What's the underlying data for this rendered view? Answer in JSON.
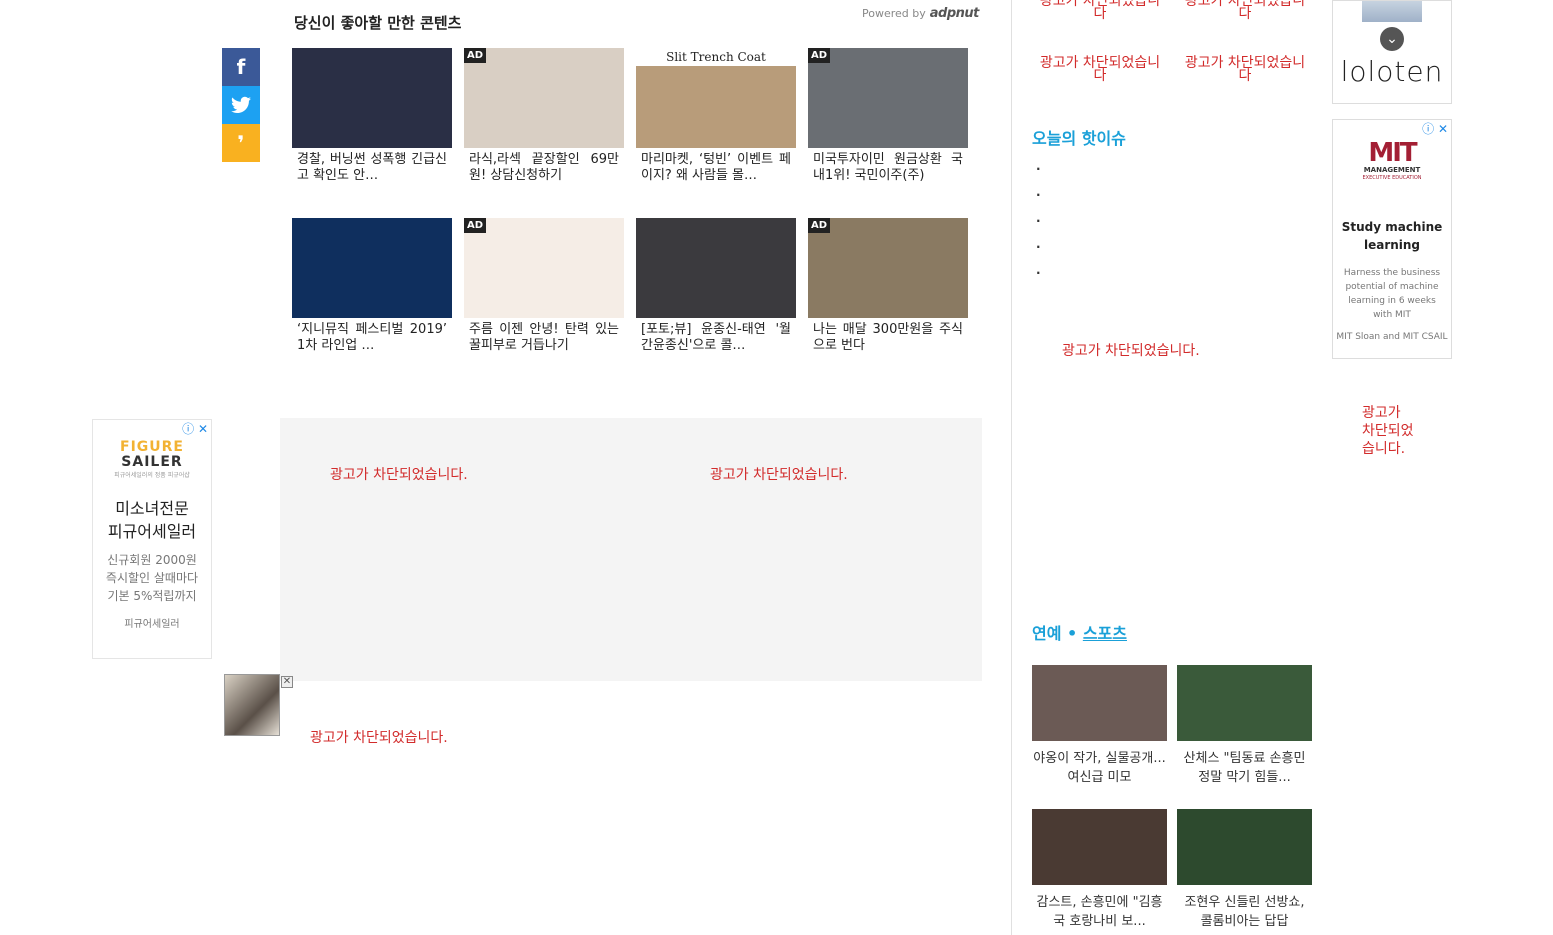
{
  "recommend": {
    "title": "당신이 좋아할 만한 콘텐츠",
    "powered_by": "Powered by",
    "powered_brand": "adpnut",
    "ad_tag": "AD",
    "cards": [
      {
        "caption": "경찰, 버닝썬 성폭행 긴급신고 확인도 안…",
        "ad": false,
        "thumb_color": "#2a2f45"
      },
      {
        "caption": "라식,라섹 끝장할인 69만원! 상담신청하기",
        "ad": true,
        "thumb_color": "#d9cfc4"
      },
      {
        "caption": "마리마켓, ‘텅빈’ 이벤트 페이지? 왜 사람들 몰…",
        "ad": false,
        "thumb_color": "#b89c7a",
        "thumb_text": "Slit Trench Coat"
      },
      {
        "caption": "미국투자이민 원금상환 국내1위! 국민이주(주)",
        "ad": true,
        "thumb_color": "#6a6e73"
      },
      {
        "caption": "‘지니뮤직 페스티벌 2019’ 1차 라인업 …",
        "ad": false,
        "thumb_color": "#0f2f5e"
      },
      {
        "caption": "주름 이젠 안녕! 탄력 있는 꿀피부로 거듭나기",
        "ad": true,
        "thumb_color": "#f5ede6"
      },
      {
        "caption": "[포토;뷰] 윤종신-태연 '월간윤종신'으로 콜…",
        "ad": false,
        "thumb_color": "#3b3a3e"
      },
      {
        "caption": "나는 매달 300만원을 주식으로 번다",
        "ad": true,
        "thumb_color": "#8a7a62"
      }
    ]
  },
  "social": {
    "facebook": "f",
    "twitter": "t",
    "kakaostory": "❜"
  },
  "blocked_text": "광고가 차단되었습니다.",
  "blocked_text_pieces": {
    "line1": "광고가 차단되었습니",
    "line2": "다"
  },
  "left_ad": {
    "logo_top": "FIGURE",
    "logo_bottom": "SAILER",
    "logo_sub": "피규어세일러의 정품 피규어샵",
    "title1": "미소녀전문",
    "title2": "피규어세일러",
    "desc1": "신규회원 2000원",
    "desc2": "즉시할인 살때마다",
    "desc3": "기본 5%적립까지",
    "brand": "피규어세일러",
    "close": "ⓘ ✕"
  },
  "hot_issue": {
    "title": "오늘의 핫이슈",
    "items": [
      "",
      "",
      "",
      "",
      ""
    ]
  },
  "sports": {
    "title_part1": "연예",
    "title_sep": " • ",
    "title_part2": "스포츠",
    "cards": [
      {
        "caption": "야옹이 작가, 실물공개...여신급 미모",
        "thumb_color": "#6b5a55"
      },
      {
        "caption": "산체스 \"팀동료 손흥민 정말 막기 힘들...",
        "thumb_color": "#3a5a3a"
      },
      {
        "caption": "감스트, 손흥민에 \"김흥국 호랑나비 보...",
        "thumb_color": "#4a3a33"
      },
      {
        "caption": "조현우 신들린 선방쇼, 콜롬비아는 답답",
        "thumb_color": "#2d4a2e"
      }
    ]
  },
  "loloten": {
    "word": "loloten",
    "chevron": "⌄"
  },
  "mit_ad": {
    "logo": "MIT",
    "mgmt": "MANAGEMENT",
    "exec": "EXECUTIVE EDUCATION",
    "headline1": "Study machine",
    "headline2": "learning",
    "body": "Harness the business potential of machine learning in 6 weeks with MIT",
    "foot": "MIT Sloan and MIT CSAIL",
    "close": "ⓘ ✕"
  },
  "far_blocked": {
    "l1": "광고가",
    "l2": "차단되었",
    "l3": "습니다."
  },
  "tiny_close": "✕"
}
